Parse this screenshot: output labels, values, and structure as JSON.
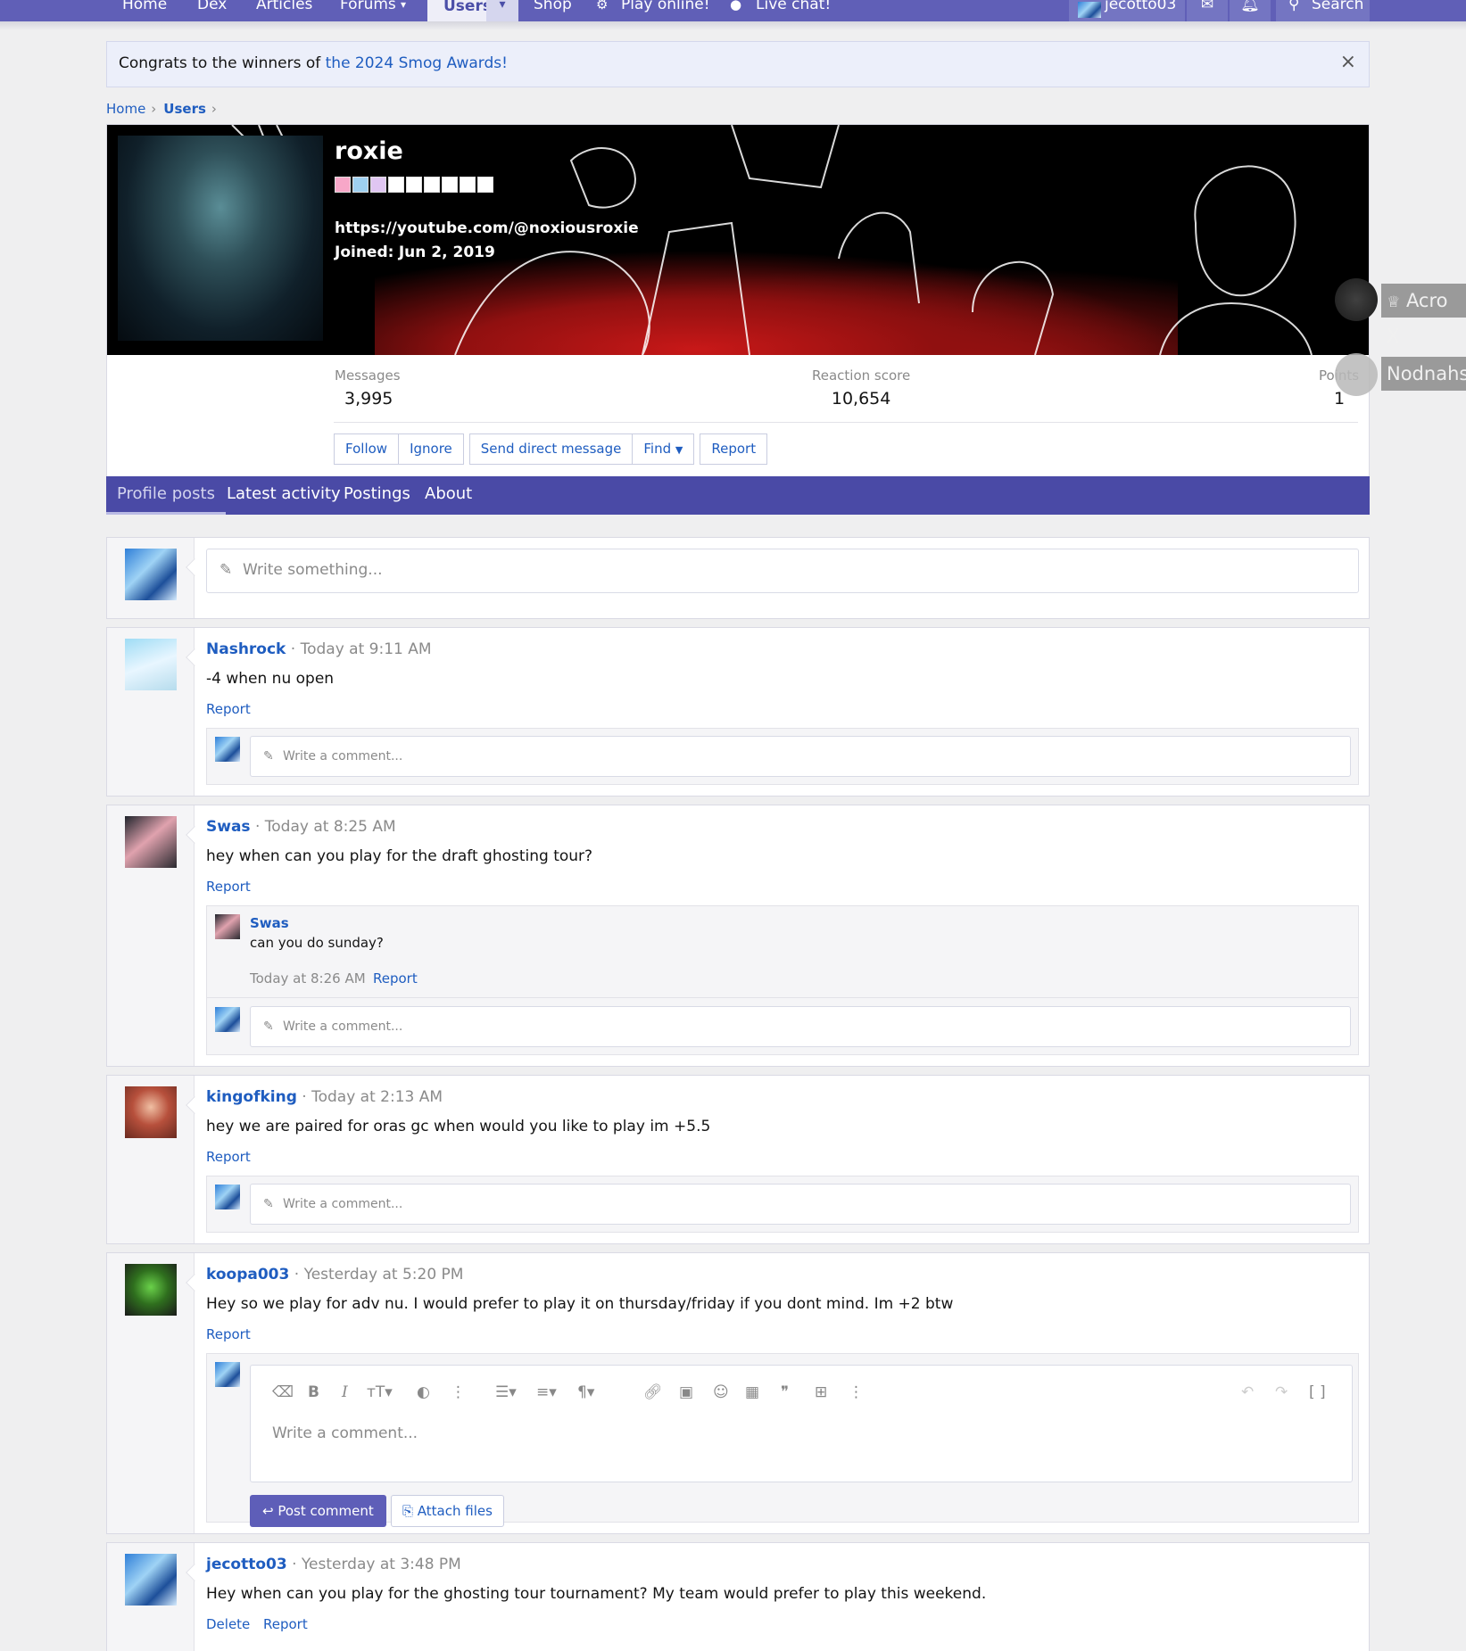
{
  "nav": {
    "items": [
      "Home",
      "Dex",
      "Articles",
      "Forums",
      "Users",
      "Shop",
      "Play online!",
      "Live chat!"
    ],
    "account": "jecotto03",
    "search": "Search"
  },
  "notice": {
    "prefix": "Congrats to the winners of ",
    "link": "the 2024 Smog Awards!",
    "close": "×"
  },
  "breadcrumb": [
    "Home",
    "Users"
  ],
  "profile": {
    "username": "roxie",
    "website": "https://youtube.com/@noxiousroxie",
    "joined_label": "Joined:",
    "joined_date": "Jun 2, 2019",
    "stats": [
      {
        "label": "Messages",
        "value": "3,995"
      },
      {
        "label": "Reaction score",
        "value": "10,654"
      },
      {
        "label": "Points",
        "value": "1"
      }
    ],
    "actions": [
      "Follow",
      "Ignore",
      "Send direct message",
      "Find",
      "Report"
    ]
  },
  "tabs": [
    "Profile posts",
    "Latest activity",
    "Postings",
    "About"
  ],
  "composer": {
    "placeholder": "Write something..."
  },
  "comment_placeholder": "Write a comment...",
  "posts": [
    {
      "user": "Nashrock",
      "time": "Today at 9:11 AM",
      "text": "-4 when nu open",
      "actions": [
        "Report"
      ]
    },
    {
      "user": "Swas",
      "time": "Today at 8:25 AM",
      "text": "hey when can you play for the draft ghosting tour?",
      "actions": [
        "Report"
      ],
      "reply": {
        "user": "Swas",
        "text": "can you do sunday?",
        "time": "Today at 8:26 AM",
        "action": "Report"
      }
    },
    {
      "user": "kingofking",
      "time": "Today at 2:13 AM",
      "text": "hey we are paired for oras gc when would you like to play im +5.5",
      "actions": [
        "Report"
      ]
    },
    {
      "user": "koopa003",
      "time": "Yesterday at 5:20 PM",
      "text": "Hey so we play for adv nu. I would prefer to play it on thursday/friday if you dont mind. Im +2 btw",
      "actions": [
        "Report"
      ]
    },
    {
      "user": "jecotto03",
      "time": "Yesterday at 3:48 PM",
      "text": "Hey when can you play for the ghosting tour tournament? My team would prefer to play this weekend.",
      "actions": [
        "Delete",
        "Report"
      ]
    }
  ],
  "editor": {
    "placeholder": "Write a comment...",
    "post_button": "Post comment",
    "attach_button": "Attach files"
  },
  "side_tags": [
    "Acro X",
    "Nodnahs"
  ]
}
